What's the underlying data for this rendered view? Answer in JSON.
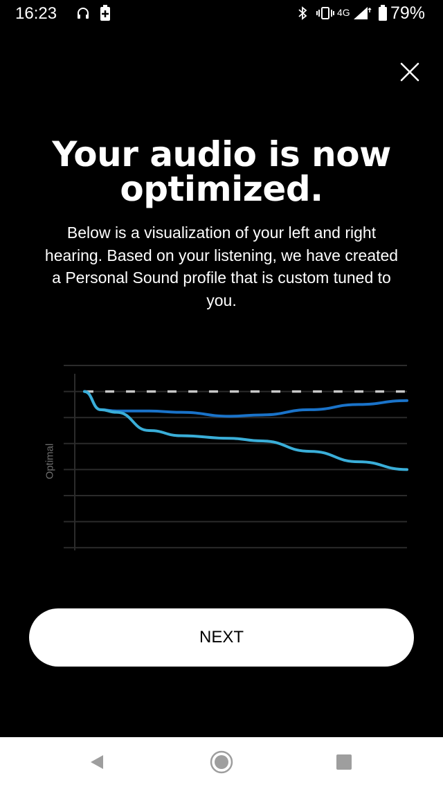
{
  "status_bar": {
    "time": "16:23",
    "network": "4G",
    "battery_percent": "79%",
    "icons": [
      "headphones-icon",
      "battery-saver-icon",
      "bluetooth-icon",
      "vibrate-icon",
      "signal-icon",
      "battery-icon"
    ]
  },
  "screen": {
    "title": "Your audio is now optimized.",
    "description": "Below is a visualization of your left and right hearing. Based on your listening, we have created a Personal Sound profile that is custom tuned to you.",
    "close_icon": "close-icon",
    "next_label": "NEXT"
  },
  "chart_data": {
    "type": "line",
    "xlabel": "",
    "ylabel": "Optimal",
    "grid": true,
    "ylim": [
      -6,
      1
    ],
    "x": [
      0,
      0.05,
      0.1,
      0.2,
      0.3,
      0.45,
      0.55,
      0.7,
      0.85,
      1.0
    ],
    "reference": {
      "style": "dashed",
      "values": [
        0,
        0,
        0,
        0,
        0,
        0,
        0,
        0,
        0,
        0
      ]
    },
    "series": [
      {
        "color": "#1a73c9",
        "values": [
          0,
          -0.7,
          -0.75,
          -0.75,
          -0.8,
          -0.95,
          -0.9,
          -0.7,
          -0.5,
          -0.35
        ]
      },
      {
        "color": "#3aaed8",
        "values": [
          0,
          -0.7,
          -0.8,
          -1.5,
          -1.7,
          -1.8,
          -1.9,
          -2.3,
          -2.7,
          -3.0
        ]
      }
    ],
    "colors": {
      "grid": "#2b2b2b",
      "reference": "#c8c8c8"
    }
  },
  "nav_bar": {
    "icons": [
      "back-icon",
      "home-icon",
      "recents-icon"
    ]
  }
}
